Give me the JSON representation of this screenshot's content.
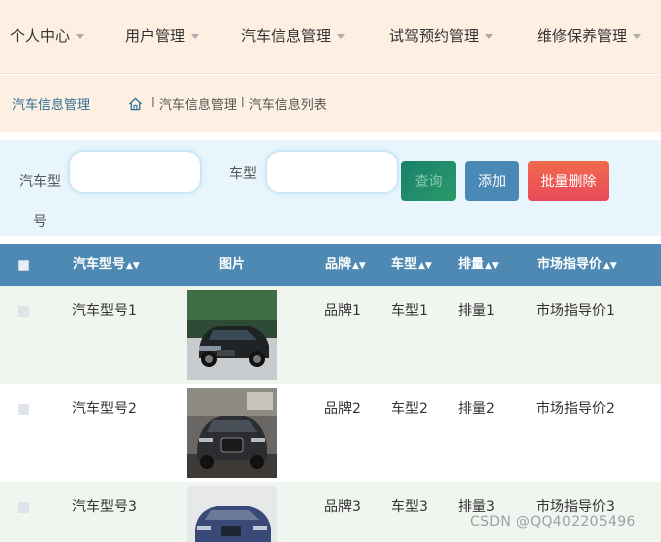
{
  "nav": {
    "items": [
      {
        "label": "个人中心"
      },
      {
        "label": "用户管理"
      },
      {
        "label": "汽车信息管理"
      },
      {
        "label": "试驾预约管理"
      },
      {
        "label": "维修保养管理"
      }
    ]
  },
  "breadcrumb": {
    "title": "汽车信息管理",
    "separator": "I",
    "items": [
      "汽车信息管理",
      "汽车信息列表"
    ]
  },
  "search": {
    "model_label": "汽车型号",
    "model_label_line1": "汽车型",
    "model_label_line2": "号",
    "model_value": "",
    "type_label": "车型",
    "type_value": "",
    "query_button": "查询",
    "add_button": "添加",
    "batch_delete_button": "批量删除"
  },
  "table": {
    "columns": {
      "model": "汽车型号",
      "image": "图片",
      "brand": "品牌",
      "type": "车型",
      "displacement": "排量",
      "price": "市场指导价"
    },
    "rows": [
      {
        "model": "汽车型号1",
        "brand": "品牌1",
        "type": "车型1",
        "displacement": "排量1",
        "price": "市场指导价1",
        "image_icon": "car-photo-black-audi"
      },
      {
        "model": "汽车型号2",
        "brand": "品牌2",
        "type": "车型2",
        "displacement": "排量2",
        "price": "市场指导价2",
        "image_icon": "car-photo-grey-audi-showroom"
      },
      {
        "model": "汽车型号3",
        "brand": "品牌3",
        "type": "车型3",
        "displacement": "排量3",
        "price": "市场指导价3",
        "image_icon": "car-photo-blue-suv"
      }
    ]
  },
  "watermark": "CSDN @QQ402205496",
  "colors": {
    "nav_bg": "#fdf0e3",
    "search_bg": "#e9f5fc",
    "table_header": "#4d89b3",
    "add_button": "#4a88b6",
    "delete_button": "#ea4a5d",
    "query_button": "#17806a"
  }
}
